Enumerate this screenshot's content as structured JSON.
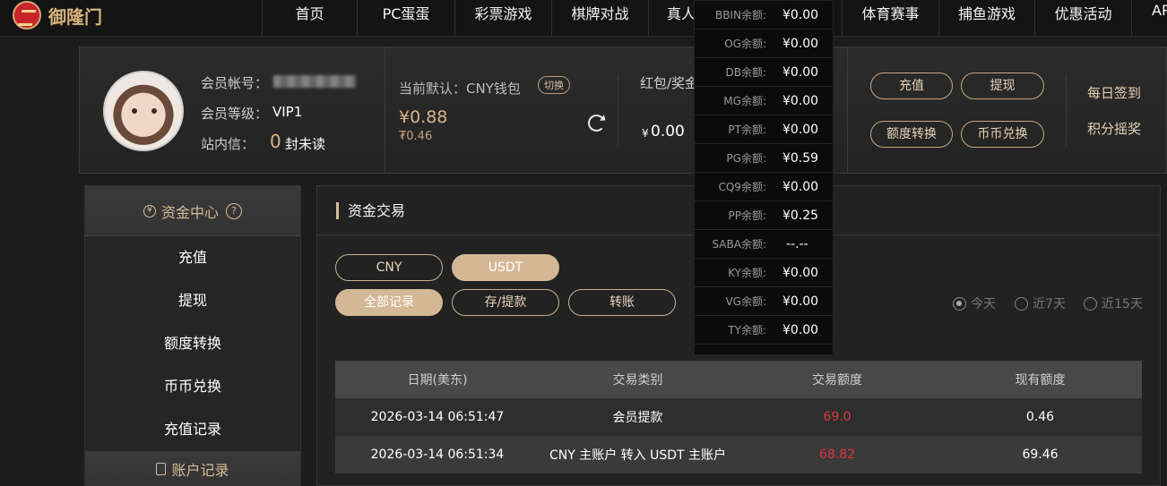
{
  "nav": {
    "logo_text": "御隆门",
    "items": [
      "首页",
      "PC蛋蛋",
      "彩票游戏",
      "棋牌对战",
      "真人",
      "体育赛事",
      "捕鱼游戏",
      "优惠活动",
      "AP"
    ]
  },
  "account": {
    "member_id_label": "会员帐号：",
    "level_label": "会员等级：",
    "level_value": "VIP1",
    "inbox_label": "站内信：",
    "inbox_count": "0",
    "inbox_suffix": "封未读",
    "wallet_label": "当前默认：CNY钱包",
    "switch_label": "切换",
    "balance_main": "¥0.88",
    "balance_sub": "₮0.46",
    "redpacket_label": "红包/奖金",
    "redpacket_currency": "¥",
    "redpacket_value": "0.00",
    "buttons": [
      "充值",
      "提现",
      "额度转换",
      "币币兑换"
    ],
    "daily_signin": "每日签到",
    "points_lottery": "积分摇奖"
  },
  "sidebar": {
    "title": "资金中心",
    "help": "?",
    "items": [
      "充值",
      "提现",
      "额度转换",
      "币币兑换",
      "充值记录"
    ],
    "footer": "账户记录"
  },
  "main": {
    "title": "资金交易",
    "currency_tabs": [
      "CNY",
      "USDT"
    ],
    "active_currency": "USDT",
    "record_tabs": [
      "全部记录",
      "存/提款",
      "转账"
    ],
    "active_record": "全部记录",
    "ranges": [
      "今天",
      "近7天",
      "近15天"
    ],
    "active_range": "今天",
    "table": {
      "headers": [
        "日期(美东)",
        "交易类别",
        "交易额度",
        "现有额度"
      ],
      "rows": [
        [
          "2026-03-14 06:51:47",
          "会员提款",
          "69.0",
          "0.46"
        ],
        [
          "2026-03-14 06:51:34",
          "CNY 主账户 转入 USDT 主账户",
          "68.82",
          "69.46"
        ]
      ]
    }
  },
  "dropdown": {
    "rows": [
      {
        "label": "BBIN余额:",
        "value": "¥0.00"
      },
      {
        "label": "OG余额:",
        "value": "¥0.00"
      },
      {
        "label": "DB余额:",
        "value": "¥0.00"
      },
      {
        "label": "MG余额:",
        "value": "¥0.00"
      },
      {
        "label": "PT余额:",
        "value": "¥0.00"
      },
      {
        "label": "PG余额:",
        "value": "¥0.59"
      },
      {
        "label": "CQ9余额:",
        "value": "¥0.00"
      },
      {
        "label": "PP余额:",
        "value": "¥0.25"
      },
      {
        "label": "SABA余额:",
        "value": "--.--"
      },
      {
        "label": "KY余额:",
        "value": "¥0.00"
      },
      {
        "label": "VG余额:",
        "value": "¥0.00"
      },
      {
        "label": "TY余额:",
        "value": "¥0.00"
      }
    ]
  },
  "colors": {
    "accent": "#d4b896",
    "negative": "#e0333b",
    "background": "#1c1c1c"
  }
}
